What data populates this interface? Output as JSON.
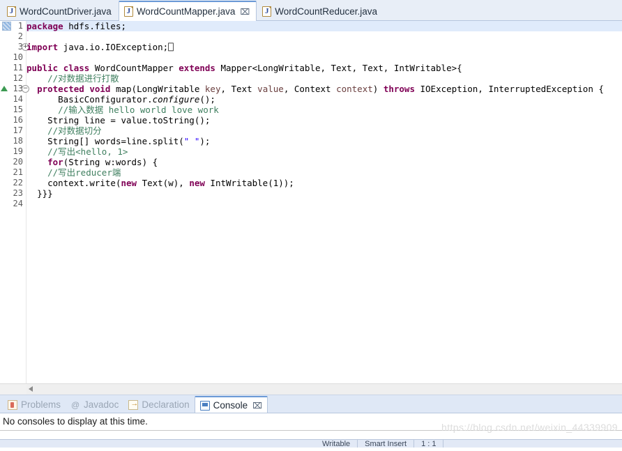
{
  "editor_tabs": [
    {
      "label": "WordCountDriver.java",
      "icon": "java-file-icon",
      "active": false,
      "closable": false
    },
    {
      "label": "WordCountMapper.java",
      "icon": "java-file-icon",
      "active": true,
      "closable": true,
      "close_glyph": "⌧"
    },
    {
      "label": "WordCountReducer.java",
      "icon": "java-file-icon",
      "active": false,
      "closable": false
    }
  ],
  "code": {
    "language": "java",
    "highlighted_line": 1,
    "lines": [
      {
        "no": "1",
        "marker": "occurrence",
        "fold": null,
        "indent": 0,
        "tokens": [
          {
            "t": "package",
            "c": "kw"
          },
          {
            "t": " hdfs.files;",
            "c": "pl"
          }
        ]
      },
      {
        "no": "2",
        "marker": null,
        "fold": null,
        "indent": 0,
        "tokens": []
      },
      {
        "no": "3",
        "marker": null,
        "fold": "expand",
        "indent": 0,
        "tokens": [
          {
            "t": "import",
            "c": "kw"
          },
          {
            "t": " java.io.IOException;",
            "c": "pl"
          },
          {
            "t": "⎕",
            "c": "fold-placeholder"
          }
        ]
      },
      {
        "no": "10",
        "marker": null,
        "fold": null,
        "indent": 0,
        "tokens": []
      },
      {
        "no": "11",
        "marker": null,
        "fold": null,
        "indent": 0,
        "tokens": [
          {
            "t": "public ",
            "c": "kw"
          },
          {
            "t": "class ",
            "c": "kw"
          },
          {
            "t": "WordCountMapper ",
            "c": "pl"
          },
          {
            "t": "extends",
            "c": "kw"
          },
          {
            "t": " Mapper<LongWritable, Text, Text, IntWritable>{",
            "c": "pl"
          }
        ]
      },
      {
        "no": "12",
        "marker": null,
        "fold": null,
        "indent": 2,
        "tokens": [
          {
            "t": "//对数据进行打散",
            "c": "cm"
          }
        ]
      },
      {
        "no": "13",
        "marker": "warning",
        "fold": "collapse",
        "indent": 1,
        "tokens": [
          {
            "t": "protected ",
            "c": "kw"
          },
          {
            "t": "void ",
            "c": "kw"
          },
          {
            "t": "map(LongWritable ",
            "c": "pl"
          },
          {
            "t": "key",
            "c": "pm"
          },
          {
            "t": ", Text ",
            "c": "pl"
          },
          {
            "t": "value",
            "c": "pm"
          },
          {
            "t": ", Context ",
            "c": "pl"
          },
          {
            "t": "context",
            "c": "pm"
          },
          {
            "t": ") ",
            "c": "pl"
          },
          {
            "t": "throws",
            "c": "kw"
          },
          {
            "t": " IOException, InterruptedException {",
            "c": "pl"
          }
        ]
      },
      {
        "no": "14",
        "marker": null,
        "fold": null,
        "indent": 3,
        "tokens": [
          {
            "t": "BasicConfigurator.",
            "c": "pl"
          },
          {
            "t": "configure",
            "c": "it"
          },
          {
            "t": "();",
            "c": "pl"
          }
        ]
      },
      {
        "no": "15",
        "marker": null,
        "fold": null,
        "indent": 3,
        "tokens": [
          {
            "t": "//输入数据 hello world love work",
            "c": "cm"
          }
        ]
      },
      {
        "no": "16",
        "marker": null,
        "fold": null,
        "indent": 2,
        "tokens": [
          {
            "t": "String line = value.toString();",
            "c": "pl"
          }
        ]
      },
      {
        "no": "17",
        "marker": null,
        "fold": null,
        "indent": 2,
        "tokens": [
          {
            "t": "//对数据切分",
            "c": "cm"
          }
        ]
      },
      {
        "no": "18",
        "marker": null,
        "fold": null,
        "indent": 2,
        "tokens": [
          {
            "t": "String[] words=line.split(",
            "c": "pl"
          },
          {
            "t": "\" \"",
            "c": "st"
          },
          {
            "t": ");",
            "c": "pl"
          }
        ]
      },
      {
        "no": "19",
        "marker": null,
        "fold": null,
        "indent": 2,
        "tokens": [
          {
            "t": "//写出<hello, 1>",
            "c": "cm"
          }
        ]
      },
      {
        "no": "20",
        "marker": null,
        "fold": null,
        "indent": 2,
        "tokens": [
          {
            "t": "for",
            "c": "kw"
          },
          {
            "t": "(String w:words) {",
            "c": "pl"
          }
        ]
      },
      {
        "no": "21",
        "marker": null,
        "fold": null,
        "indent": 2,
        "tokens": [
          {
            "t": "//写出reducer端",
            "c": "cm"
          }
        ]
      },
      {
        "no": "22",
        "marker": null,
        "fold": null,
        "indent": 2,
        "tokens": [
          {
            "t": "context.write(",
            "c": "pl"
          },
          {
            "t": "new",
            "c": "kw"
          },
          {
            "t": " Text(w), ",
            "c": "pl"
          },
          {
            "t": "new",
            "c": "kw"
          },
          {
            "t": " IntWritable(1));",
            "c": "pl"
          }
        ]
      },
      {
        "no": "23",
        "marker": null,
        "fold": null,
        "indent": 1,
        "tokens": [
          {
            "t": "}}}",
            "c": "pl"
          }
        ]
      },
      {
        "no": "24",
        "marker": null,
        "fold": null,
        "indent": 0,
        "tokens": []
      }
    ]
  },
  "view_tabs": [
    {
      "label": "Problems",
      "icon": "problems-icon",
      "active": false,
      "closable": false
    },
    {
      "label": "Javadoc",
      "icon": "javadoc-icon",
      "active": false,
      "closable": false
    },
    {
      "label": "Declaration",
      "icon": "declaration-icon",
      "active": false,
      "closable": false
    },
    {
      "label": "Console",
      "icon": "console-icon",
      "active": true,
      "closable": true,
      "close_glyph": "⌧"
    }
  ],
  "console": {
    "message": "No consoles to display at this time."
  },
  "status_bar": {
    "writable": "Writable",
    "insert_mode": "Smart Insert",
    "position": "1 : 1"
  },
  "watermark": {
    "text": "https://blog.csdn.net/weixin_44339909"
  },
  "colors": {
    "keyword": "#7f0055",
    "comment": "#3f7f5f",
    "string": "#2a00ff",
    "parameter": "#6a3e3e",
    "tab_bar_bg": "#e8eef7",
    "active_tab_border": "#6b9ad6",
    "line_highlight": "#e0ebfb",
    "warning_marker": "#3c9a52"
  }
}
